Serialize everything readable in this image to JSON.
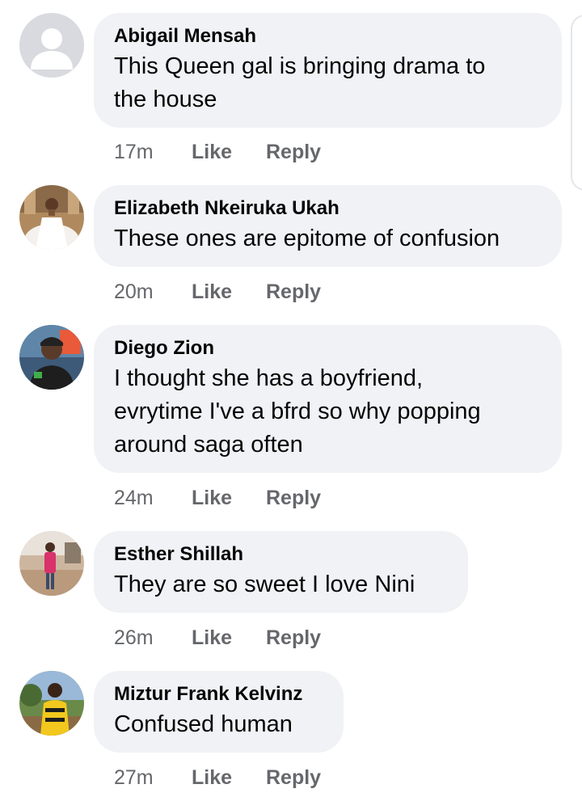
{
  "comments": [
    {
      "author": "Abigail Mensah",
      "lines": [
        "This Queen gal is bringing drama to",
        "the house"
      ],
      "time": "17m",
      "like_label": "Like",
      "reply_label": "Reply",
      "avatar": "default-profile-icon"
    },
    {
      "author": "Elizabeth Nkeiruka Ukah",
      "lines": [
        "These ones are epitome of confusion"
      ],
      "time": "20m",
      "like_label": "Like",
      "reply_label": "Reply",
      "avatar": "profile-photo-bride"
    },
    {
      "author": "Diego Zion",
      "lines": [
        "I thought she has a boyfriend,",
        "evrytime I've a bfrd so why popping",
        "around saga often"
      ],
      "time": "24m",
      "like_label": "Like",
      "reply_label": "Reply",
      "avatar": "profile-photo-man-cap"
    },
    {
      "author": "Esther Shillah",
      "lines": [
        "They are so sweet I love Nini"
      ],
      "time": "26m",
      "like_label": "Like",
      "reply_label": "Reply",
      "avatar": "profile-photo-woman-outdoors"
    },
    {
      "author": "Miztur Frank Kelvinz",
      "lines": [
        "Confused human"
      ],
      "time": "27m",
      "like_label": "Like",
      "reply_label": "Reply",
      "avatar": "profile-photo-man-yellow-jersey"
    }
  ],
  "colors": {
    "bubble": "#f0f2f5",
    "text": "#050505",
    "meta": "#65676b"
  }
}
